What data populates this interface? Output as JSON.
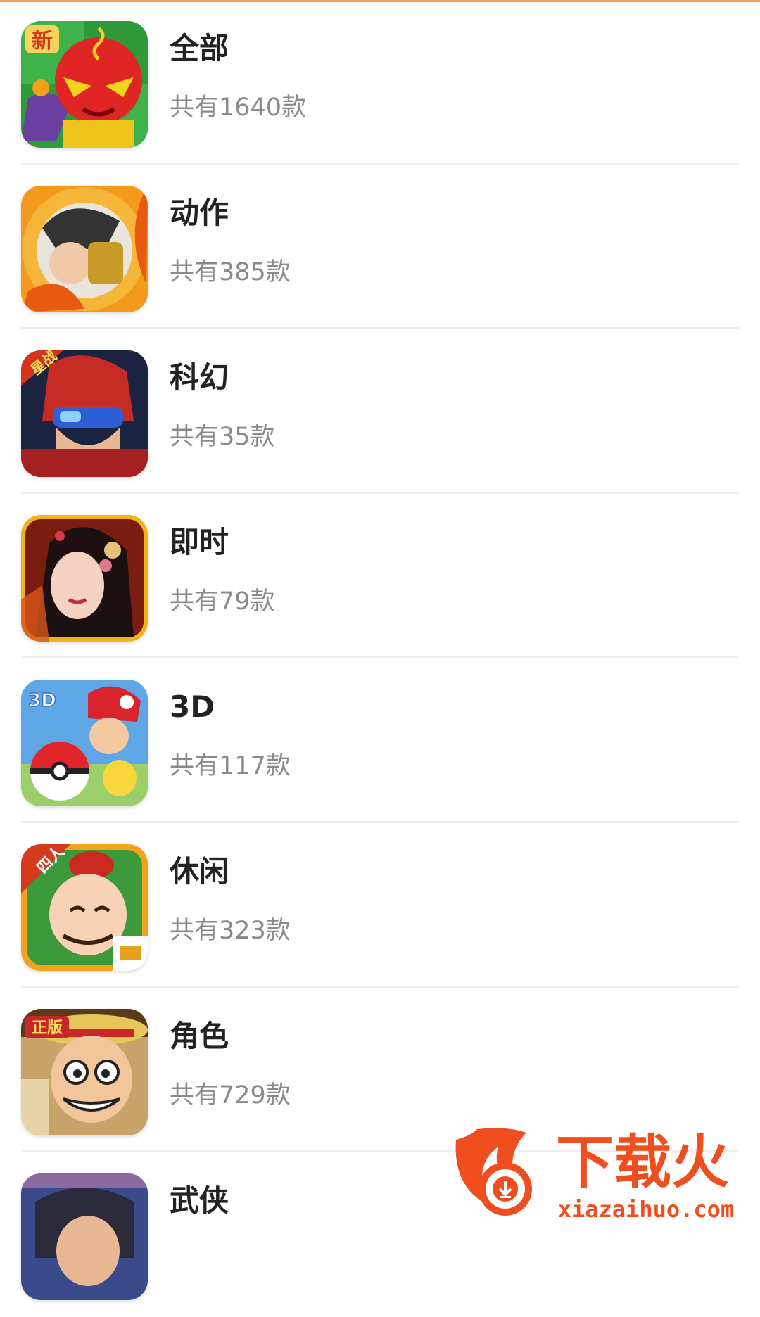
{
  "colors": {
    "accent": "#f0a05a",
    "title": "#222222",
    "count": "#8a8a8a",
    "divider": "#eeeeee",
    "watermark": "#f04e1e"
  },
  "categories": [
    {
      "title": "全部",
      "count": "共有1640款",
      "icon": "red-monster-game-icon",
      "badge": "新"
    },
    {
      "title": "动作",
      "count": "共有385款",
      "icon": "fire-warrior-game-icon",
      "badge": ""
    },
    {
      "title": "科幻",
      "count": "共有35款",
      "icon": "sci-fi-soldier-game-icon",
      "badge": "星战"
    },
    {
      "title": "即时",
      "count": "共有79款",
      "icon": "ancient-princess-game-icon",
      "badge": ""
    },
    {
      "title": "3D",
      "count": "共有117款",
      "icon": "pokeball-trainer-game-icon",
      "badge": "3D"
    },
    {
      "title": "休闲",
      "count": "共有323款",
      "icon": "cartoon-landlord-game-icon",
      "badge": "四人"
    },
    {
      "title": "角色",
      "count": "共有729款",
      "icon": "pirate-hero-game-icon",
      "badge": "正版"
    },
    {
      "title": "武侠",
      "count": "",
      "icon": "martial-hero-game-icon",
      "badge": ""
    }
  ],
  "watermark": {
    "brand": "下载火",
    "domain": "xiazaihuo.com"
  }
}
